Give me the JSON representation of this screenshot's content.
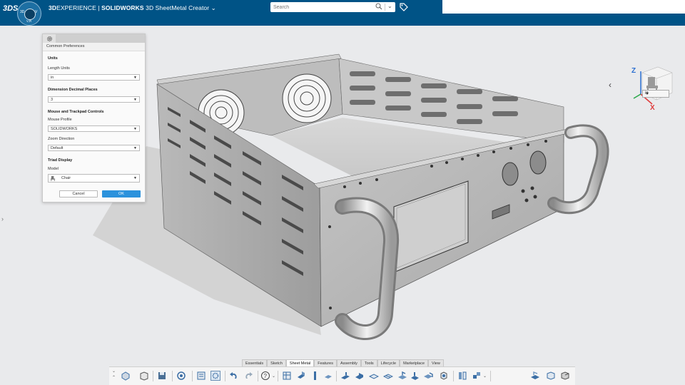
{
  "topbar": {
    "brand": "3DS",
    "compass_labels": [
      "3D",
      "V",
      "V,R"
    ],
    "title_prefix": "3D",
    "title_experience": "EXPERIENCE",
    "title_product": "SOLIDWORKS",
    "title_app": "3D SheetMetal Creator",
    "search_placeholder": "Search"
  },
  "dialog": {
    "title": "Common Preferences",
    "units_section": "Units",
    "length_units_label": "Length Units",
    "length_units_value": "in",
    "decimal_section": "Dimension Decimal Places",
    "decimal_value": "3",
    "mouse_section": "Mouse and Trackpad Controls",
    "mouse_profile_label": "Mouse Profile",
    "mouse_profile_value": "SOLIDWORKS",
    "zoom_direction_label": "Zoom Direction",
    "zoom_direction_value": "Default",
    "triad_section": "Triad Display",
    "model_label": "Model",
    "model_value": "Chair",
    "cancel_label": "Cancel",
    "ok_label": "OK"
  },
  "viewport": {
    "unit_select_value": "in",
    "axis_z": "Z",
    "axis_x": "X"
  },
  "tabs": [
    "Essentials",
    "Sketch",
    "Sheet Metal",
    "Features",
    "Assembly",
    "Tools",
    "Lifecycle",
    "Marketplace",
    "View"
  ],
  "active_tab": "Sheet Metal",
  "colors": {
    "topbar": "#005386",
    "accent": "#2b92dc",
    "axis_x": "#e03b3b",
    "axis_z": "#2b6fd1"
  }
}
